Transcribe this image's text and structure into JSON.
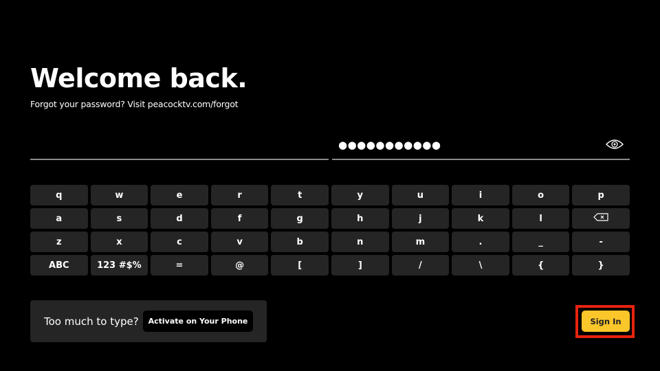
{
  "header": {
    "title": "Welcome back.",
    "subtitle": "Forgot your password? Visit peacocktv.com/forgot"
  },
  "form": {
    "username": {
      "value": "",
      "placeholder": ""
    },
    "password": {
      "value": "●●●●●●●●●●●",
      "masked_length": 11,
      "toggle_icon": "eye-icon"
    }
  },
  "keyboard": {
    "rows": [
      [
        "q",
        "w",
        "e",
        "r",
        "t",
        "y",
        "u",
        "i",
        "o",
        "p"
      ],
      [
        "a",
        "s",
        "d",
        "f",
        "g",
        "h",
        "j",
        "k",
        "l",
        "backspace"
      ],
      [
        "z",
        "x",
        "c",
        "v",
        "b",
        "n",
        "m",
        ".",
        "_",
        "-"
      ],
      [
        "ABC",
        "123 #$%",
        "=",
        "@",
        "[",
        "]",
        "/",
        "\\",
        "{",
        "}"
      ]
    ]
  },
  "phone_panel": {
    "label": "Too much to type?",
    "button_label": "Activate on Your Phone"
  },
  "signin": {
    "label": "Sign In",
    "highlighted": true
  },
  "colors": {
    "background": "#000000",
    "key_bg": "#252525",
    "accent_yellow": "#fbc62a",
    "highlight_red": "#e8230f"
  }
}
